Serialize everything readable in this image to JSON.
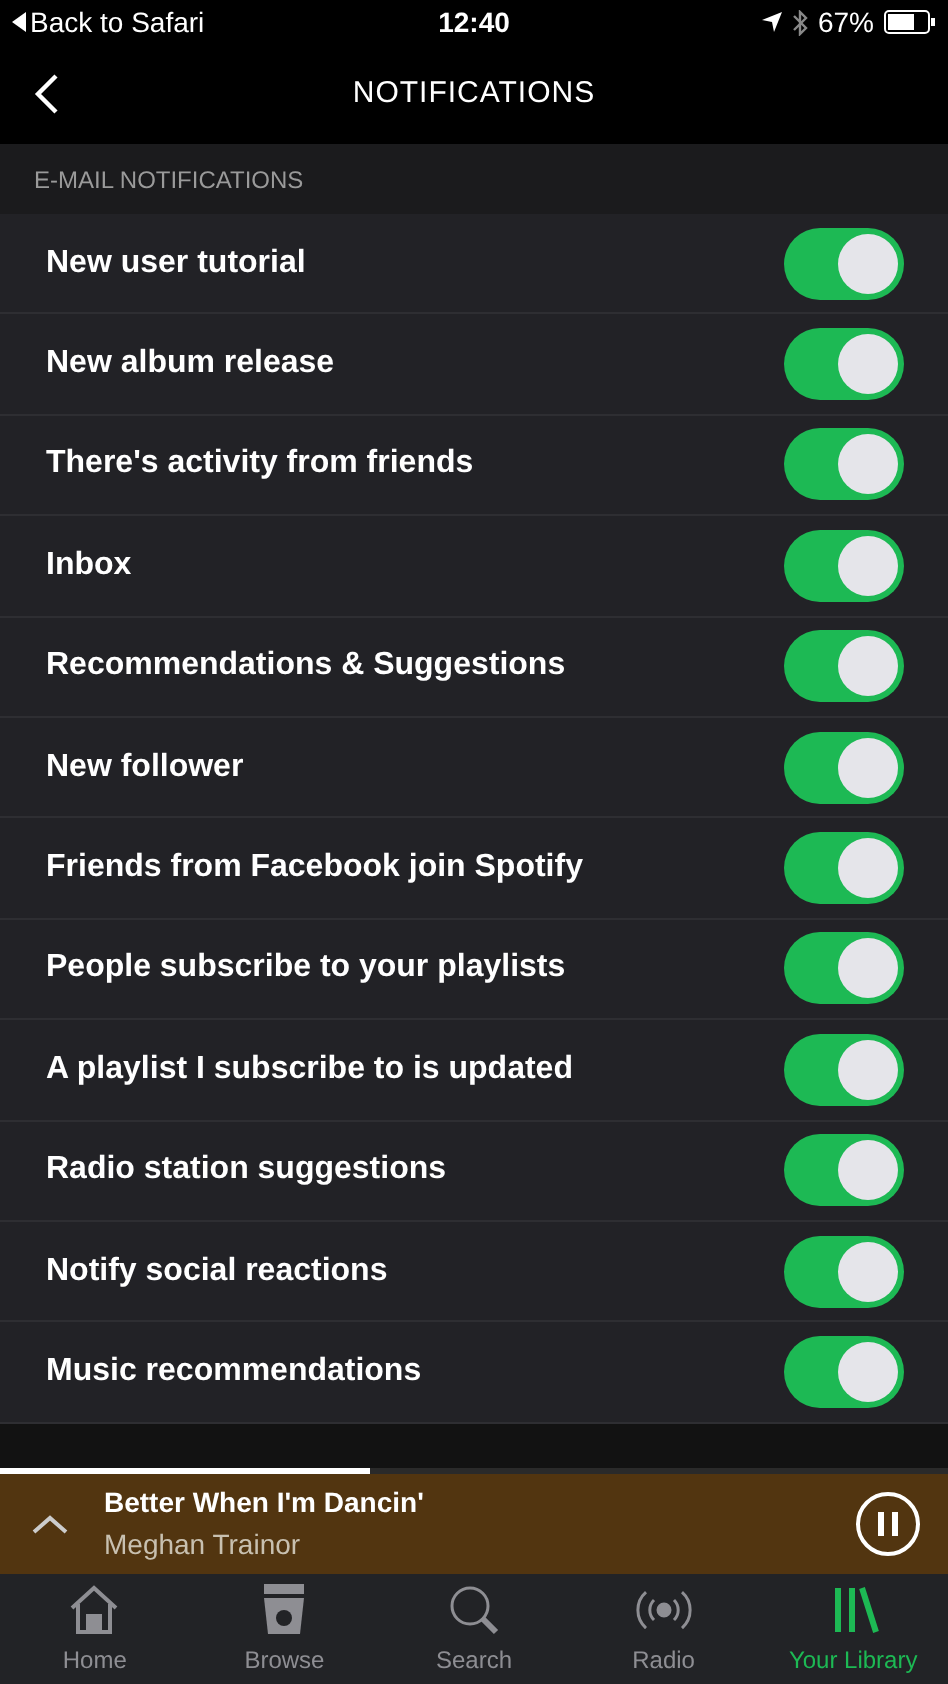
{
  "status_bar": {
    "back": "Back to Safari",
    "time": "12:40",
    "battery": "67%"
  },
  "header": {
    "title": "NOTIFICATIONS"
  },
  "section": {
    "title": "E-MAIL NOTIFICATIONS",
    "items": [
      {
        "label": "New user tutorial",
        "on": true
      },
      {
        "label": "New album release",
        "on": true
      },
      {
        "label": "There's activity from friends",
        "on": true
      },
      {
        "label": "Inbox",
        "on": true
      },
      {
        "label": "Recommendations & Suggestions",
        "on": true
      },
      {
        "label": "New follower",
        "on": true
      },
      {
        "label": "Friends from Facebook join Spotify",
        "on": true
      },
      {
        "label": "People subscribe to your playlists",
        "on": true
      },
      {
        "label": "A playlist I subscribe to is updated",
        "on": true
      },
      {
        "label": "Radio station suggestions",
        "on": true
      },
      {
        "label": "Notify social reactions",
        "on": true
      },
      {
        "label": "Music recommendations",
        "on": true
      }
    ]
  },
  "player": {
    "title": "Better When I'm Dancin'",
    "artist": "Meghan Trainor",
    "level": 0.39
  },
  "tabs": [
    {
      "label": "Home",
      "kind": "home",
      "selected": false
    },
    {
      "label": "Browse",
      "kind": "browse",
      "selected": false
    },
    {
      "label": "Search",
      "kind": "search",
      "selected": false
    },
    {
      "label": "Radio",
      "kind": "radio",
      "selected": false
    },
    {
      "label": "Your Library",
      "kind": "library",
      "selected": true
    }
  ]
}
